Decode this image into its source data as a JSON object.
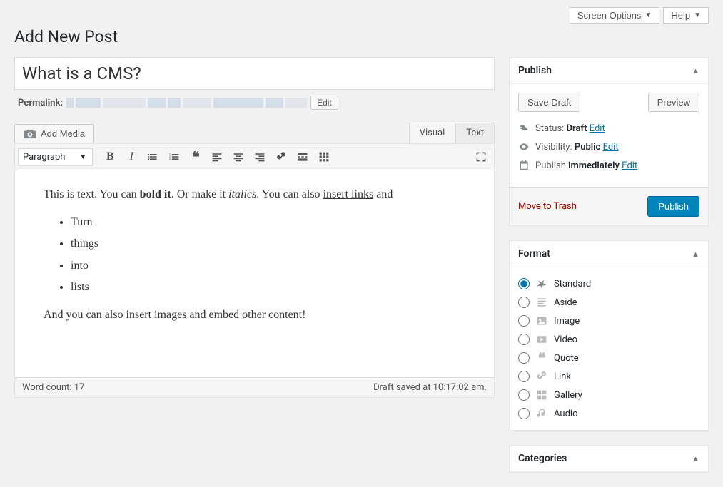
{
  "topButtons": {
    "screenOptions": "Screen Options",
    "help": "Help"
  },
  "pageTitle": "Add New Post",
  "postTitle": "What is a CMS?",
  "permalink": {
    "label": "Permalink:",
    "editBtn": "Edit"
  },
  "addMedia": "Add Media",
  "editorTabs": {
    "visual": "Visual",
    "text": "Text"
  },
  "paragraphSelect": "Paragraph",
  "content": {
    "p1_a": "This is text. You can ",
    "p1_bold": "bold it",
    "p1_b": ". Or make it ",
    "p1_italic": "italics",
    "p1_c": ". You can also ",
    "p1_link": "insert links",
    "p1_d": " and",
    "li1": "Turn",
    "li2": "things",
    "li3": "into",
    "li4": "lists",
    "p2": "And you can also insert images and embed other content!"
  },
  "footer": {
    "wordCount": "Word count: 17",
    "saved": "Draft saved at 10:17:02 am."
  },
  "publish": {
    "title": "Publish",
    "saveDraft": "Save Draft",
    "preview": "Preview",
    "statusLabel": "Status: ",
    "statusValue": "Draft",
    "visibilityLabel": "Visibility: ",
    "visibilityValue": "Public",
    "publishLabel": "Publish ",
    "publishValue": "immediately",
    "edit": "Edit",
    "trash": "Move to Trash",
    "publishBtn": "Publish"
  },
  "format": {
    "title": "Format",
    "items": [
      {
        "label": "Standard",
        "checked": true
      },
      {
        "label": "Aside",
        "checked": false
      },
      {
        "label": "Image",
        "checked": false
      },
      {
        "label": "Video",
        "checked": false
      },
      {
        "label": "Quote",
        "checked": false
      },
      {
        "label": "Link",
        "checked": false
      },
      {
        "label": "Gallery",
        "checked": false
      },
      {
        "label": "Audio",
        "checked": false
      }
    ]
  },
  "categories": {
    "title": "Categories"
  }
}
